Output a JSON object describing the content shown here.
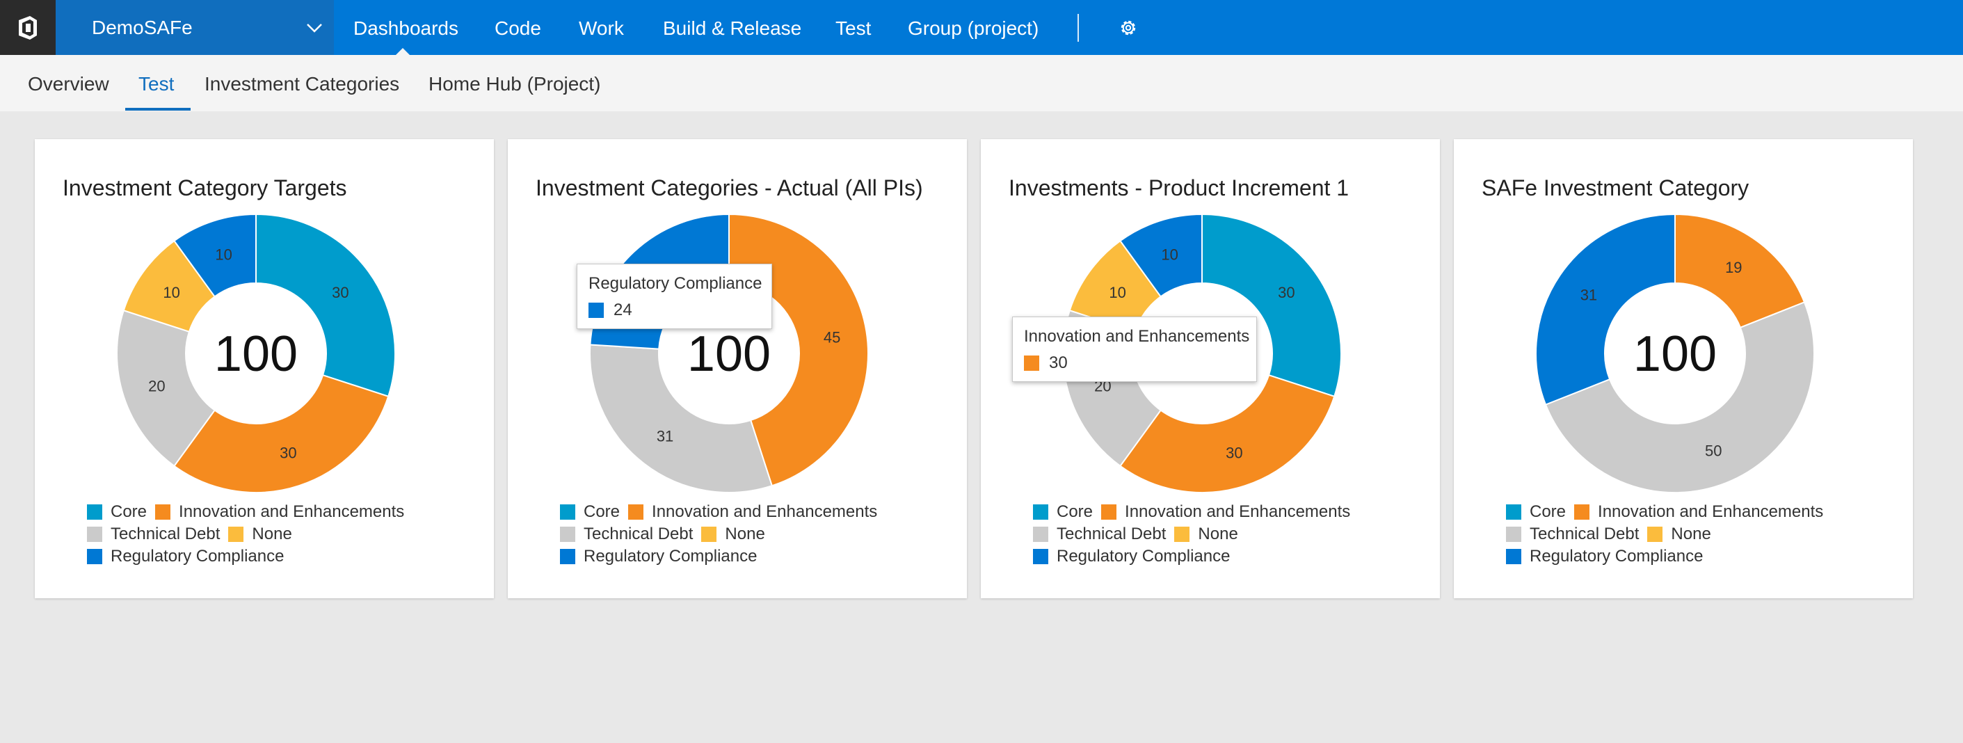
{
  "header": {
    "project": "DemoSAFe",
    "nav": [
      "Dashboards",
      "Code",
      "Work",
      "Build & Release",
      "Test",
      "Group (project)"
    ]
  },
  "subnav": {
    "tabs": [
      "Overview",
      "Test",
      "Investment Categories",
      "Home Hub (Project)"
    ],
    "active": "Test"
  },
  "colors": {
    "Core": "#009ccc",
    "Innovation and Enhancements": "#f58b1f",
    "Technical Debt": "#cbcbcb",
    "None": "#fbbc3d",
    "Regulatory Compliance": "#0078d4"
  },
  "legend": {
    "row1": [
      "Core",
      "Innovation and Enhancements"
    ],
    "row2": [
      "Technical Debt",
      "None"
    ],
    "row3": [
      "Regulatory Compliance"
    ]
  },
  "chart_data": [
    {
      "type": "pie",
      "title": "Investment Category Targets",
      "total": "100",
      "slices": [
        {
          "label": "Core",
          "value": 30
        },
        {
          "label": "Innovation and Enhancements",
          "value": 30
        },
        {
          "label": "Technical Debt",
          "value": 20
        },
        {
          "label": "None",
          "value": 10
        },
        {
          "label": "Regulatory Compliance",
          "value": 10
        }
      ]
    },
    {
      "type": "pie",
      "title": "Investment Categories - Actual (All PIs)",
      "total": "100",
      "slices": [
        {
          "label": "Innovation and Enhancements",
          "value": 45
        },
        {
          "label": "Technical Debt",
          "value": 31
        },
        {
          "label": "Regulatory Compliance",
          "value": 24
        }
      ],
      "tooltip": {
        "label": "Regulatory Compliance",
        "value": "24"
      }
    },
    {
      "type": "pie",
      "title": "Investments - Product Increment 1",
      "total": "100",
      "slices": [
        {
          "label": "Core",
          "value": 30
        },
        {
          "label": "Innovation and Enhancements",
          "value": 30
        },
        {
          "label": "Technical Debt",
          "value": 20
        },
        {
          "label": "None",
          "value": 10
        },
        {
          "label": "Regulatory Compliance",
          "value": 10
        }
      ],
      "tooltip": {
        "label": "Innovation and Enhancements",
        "value": "30"
      }
    },
    {
      "type": "pie",
      "title": "SAFe Investment Category",
      "total": "100",
      "slices": [
        {
          "label": "Innovation and Enhancements",
          "value": 19
        },
        {
          "label": "Technical Debt",
          "value": 50
        },
        {
          "label": "Regulatory Compliance",
          "value": 31
        }
      ]
    }
  ]
}
